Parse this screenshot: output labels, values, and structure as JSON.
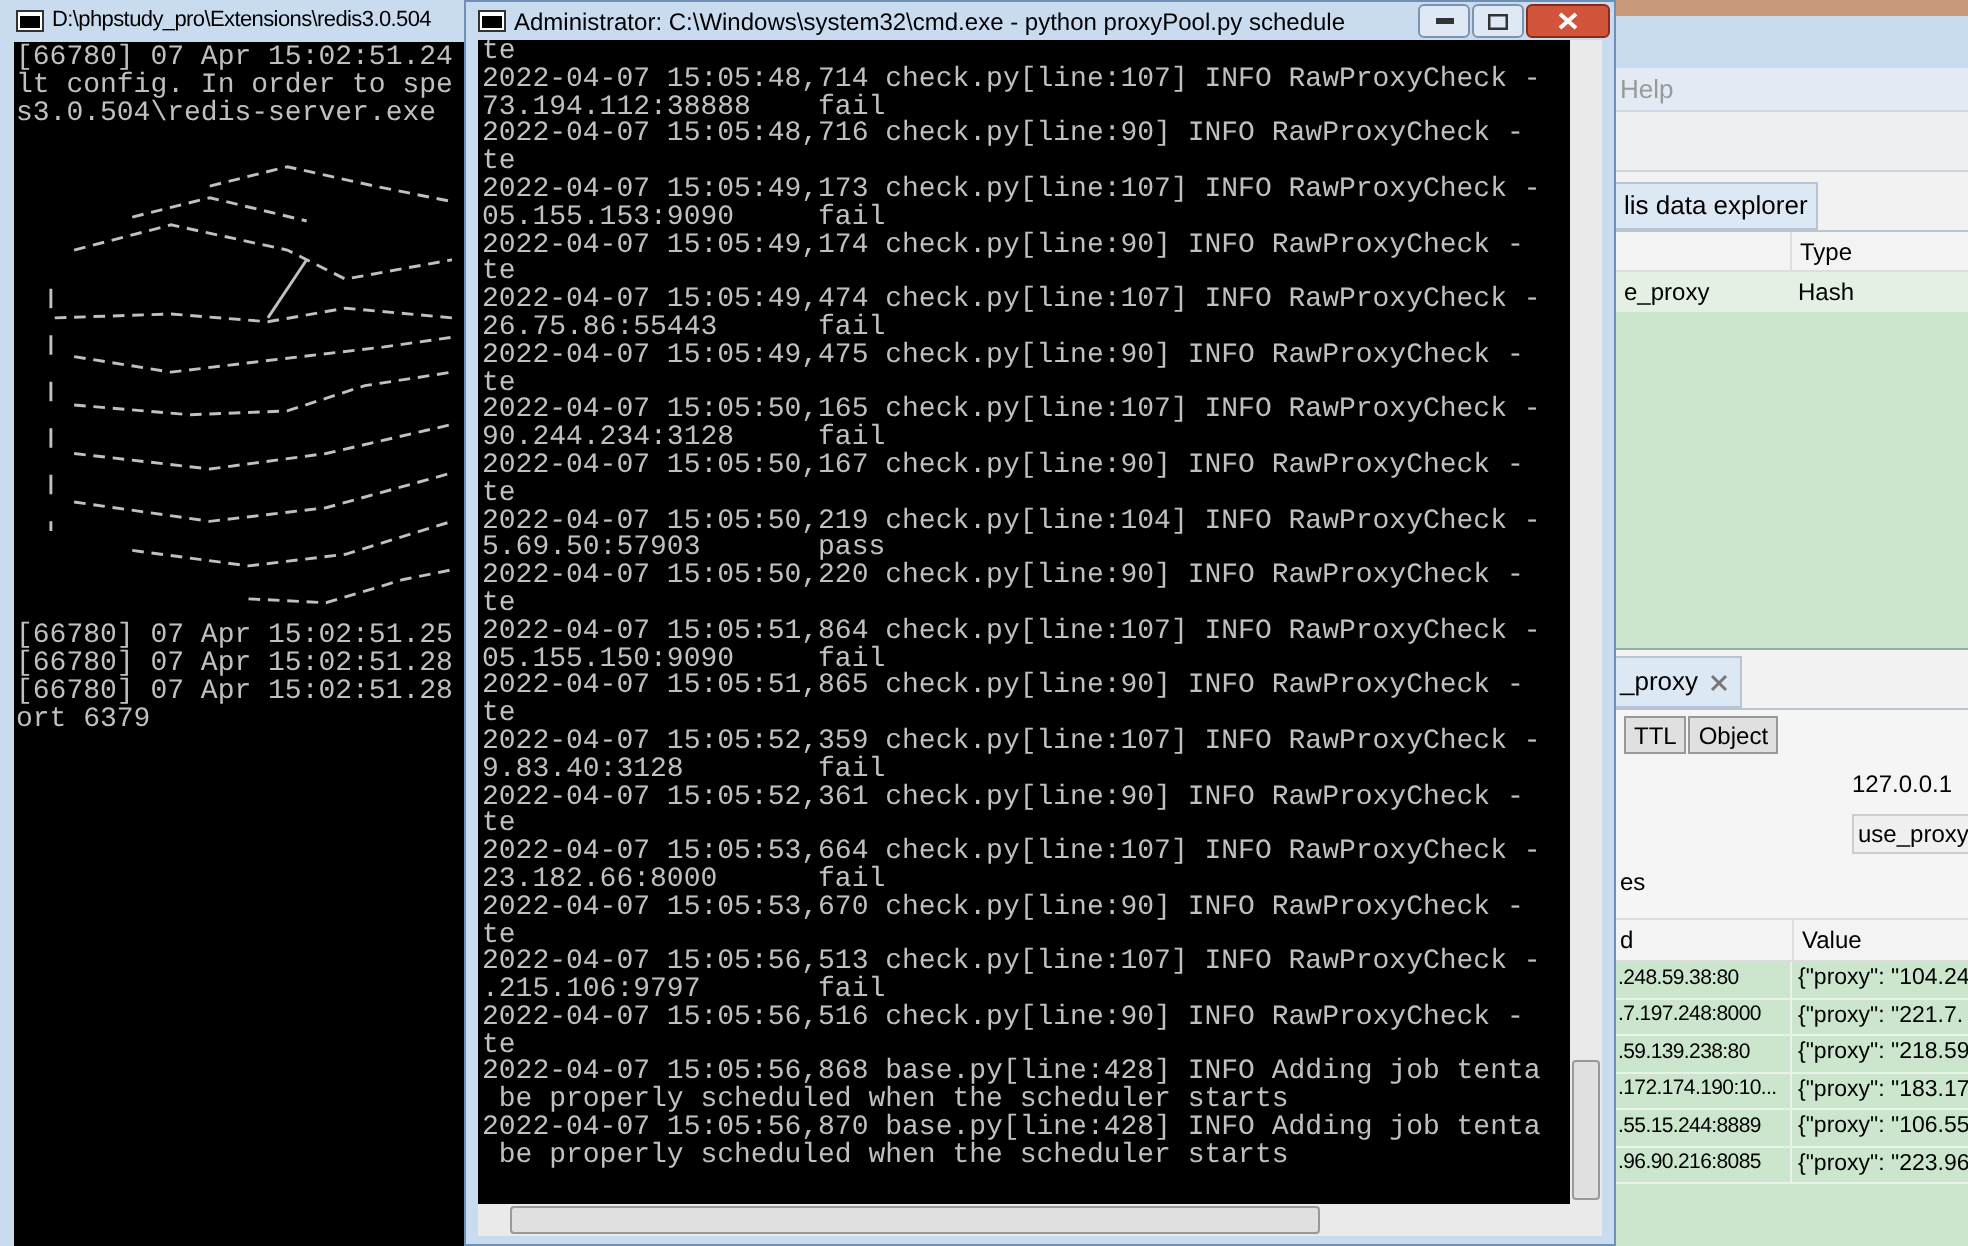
{
  "redis_window": {
    "title": "D:\\phpstudy_pro\\Extensions\\redis3.0.504",
    "lines_top": [
      "[66780] 07 Apr 15:02:51.24",
      "lt config. In order to spe",
      "s3.0.504\\redis-server.exe"
    ],
    "lines_bottom": [
      "[66780] 07 Apr 15:02:51.25",
      "[66780] 07 Apr 15:02:51.28",
      "[66780] 07 Apr 15:02:51.28",
      "ort 6379"
    ]
  },
  "cmd_window": {
    "title": "Administrator: C:\\Windows\\system32\\cmd.exe - python  proxyPool.py schedule",
    "lines": [
      "te",
      "2022-04-07 15:05:48,714 check.py[line:107] INFO RawProxyCheck -",
      "73.194.112:38888    fail",
      "2022-04-07 15:05:48,716 check.py[line:90] INFO RawProxyCheck -",
      "te",
      "2022-04-07 15:05:49,173 check.py[line:107] INFO RawProxyCheck -",
      "05.155.153:9090     fail",
      "2022-04-07 15:05:49,174 check.py[line:90] INFO RawProxyCheck -",
      "te",
      "2022-04-07 15:05:49,474 check.py[line:107] INFO RawProxyCheck -",
      "26.75.86:55443      fail",
      "2022-04-07 15:05:49,475 check.py[line:90] INFO RawProxyCheck -",
      "te",
      "2022-04-07 15:05:50,165 check.py[line:107] INFO RawProxyCheck -",
      "90.244.234:3128     fail",
      "2022-04-07 15:05:50,167 check.py[line:90] INFO RawProxyCheck -",
      "te",
      "2022-04-07 15:05:50,219 check.py[line:104] INFO RawProxyCheck -",
      "5.69.50:57903       pass",
      "2022-04-07 15:05:50,220 check.py[line:90] INFO RawProxyCheck -",
      "te",
      "2022-04-07 15:05:51,864 check.py[line:107] INFO RawProxyCheck -",
      "05.155.150:9090     fail",
      "2022-04-07 15:05:51,865 check.py[line:90] INFO RawProxyCheck -",
      "te",
      "2022-04-07 15:05:52,359 check.py[line:107] INFO RawProxyCheck -",
      "9.83.40:3128        fail",
      "2022-04-07 15:05:52,361 check.py[line:90] INFO RawProxyCheck -",
      "te",
      "2022-04-07 15:05:53,664 check.py[line:107] INFO RawProxyCheck -",
      "23.182.66:8000      fail",
      "2022-04-07 15:05:53,670 check.py[line:90] INFO RawProxyCheck -",
      "te",
      "2022-04-07 15:05:56,513 check.py[line:107] INFO RawProxyCheck -",
      ".215.106:9797       fail",
      "2022-04-07 15:05:56,516 check.py[line:90] INFO RawProxyCheck -",
      "te",
      "2022-04-07 15:05:56,868 base.py[line:428] INFO Adding job tenta",
      " be properly scheduled when the scheduler starts",
      "2022-04-07 15:05:56,870 base.py[line:428] INFO Adding job tenta",
      " be properly scheduled when the scheduler starts"
    ]
  },
  "explorer_window": {
    "menu": [
      "Help"
    ],
    "tab": "lis data explorer",
    "keys_table": {
      "type_header": "Type",
      "rows": [
        {
          "cells": [
            "e_proxy",
            "Hash"
          ],
          "selected": true
        }
      ]
    },
    "detail_tab": "_proxy",
    "subtabs": [
      {
        "label": "TTL",
        "selected": false
      },
      {
        "label": "Object",
        "selected": false
      }
    ],
    "host": "127.0.0.1",
    "key_field": "use_proxy",
    "values_label": "es",
    "values_table": {
      "columns": [
        "d",
        "Value"
      ],
      "rows": [
        [
          ".248.59.38:80",
          "{\"proxy\": \"104.24"
        ],
        [
          ".7.197.248:8000",
          "{\"proxy\": \"221.7."
        ],
        [
          ".59.139.238:80",
          "{\"proxy\": \"218.59"
        ],
        [
          ".172.174.190:10...",
          "{\"proxy\": \"183.17"
        ],
        [
          ".55.15.244:8889",
          "{\"proxy\": \"106.55"
        ],
        [
          ".96.90.216:8085",
          "{\"proxy\": \"223.96"
        ]
      ]
    }
  }
}
